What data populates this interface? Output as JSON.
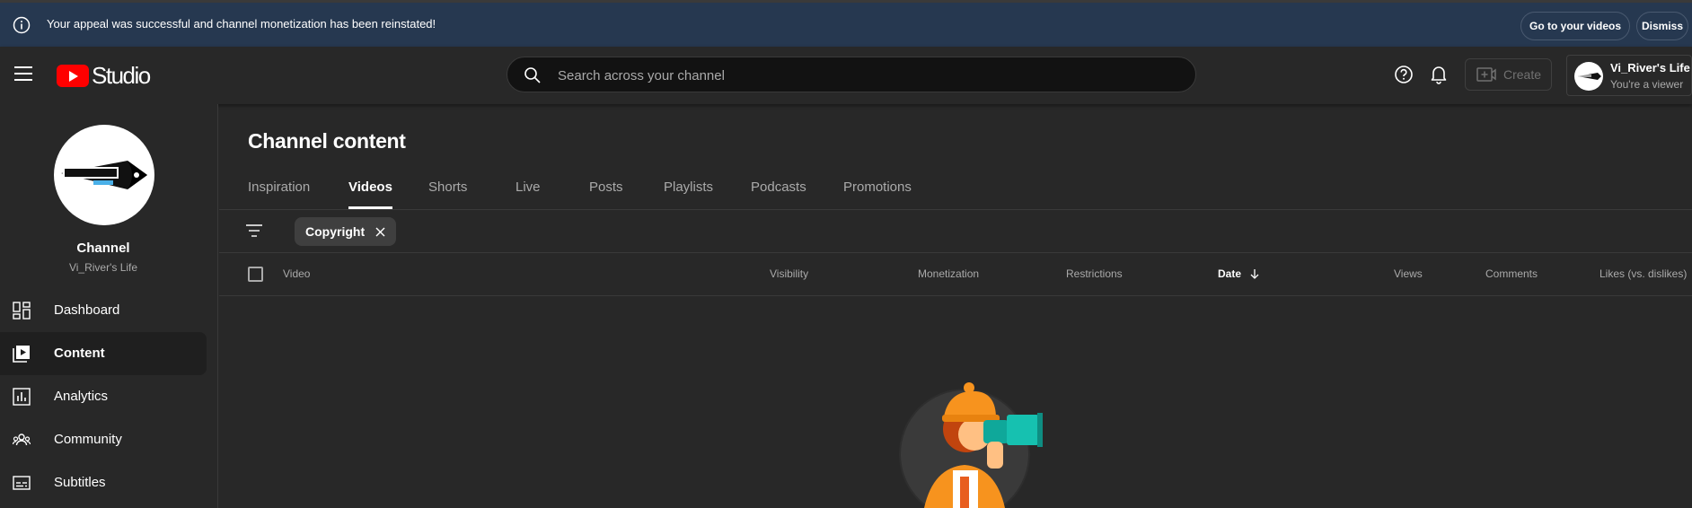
{
  "banner": {
    "message": "Your appeal was successful and channel monetization has been reinstated!",
    "go_label": "Go to your videos",
    "dismiss_label": "Dismiss"
  },
  "topbar": {
    "logo_text": "Studio",
    "search_placeholder": "Search across your channel",
    "create_label": "Create",
    "account_name": "Vi_River's Life",
    "account_role": "You're a viewer"
  },
  "sidebar": {
    "channel_title": "Channel",
    "channel_name": "Vi_River's Life",
    "items": [
      {
        "label": "Dashboard",
        "icon": "dashboard-icon"
      },
      {
        "label": "Content",
        "icon": "content-icon",
        "active": true
      },
      {
        "label": "Analytics",
        "icon": "analytics-icon"
      },
      {
        "label": "Community",
        "icon": "community-icon"
      },
      {
        "label": "Subtitles",
        "icon": "subtitles-icon"
      }
    ]
  },
  "main": {
    "title": "Channel content",
    "tabs": [
      {
        "label": "Inspiration"
      },
      {
        "label": "Videos",
        "active": true
      },
      {
        "label": "Shorts"
      },
      {
        "label": "Live"
      },
      {
        "label": "Posts"
      },
      {
        "label": "Playlists"
      },
      {
        "label": "Podcasts"
      },
      {
        "label": "Promotions"
      }
    ],
    "filter_chip": "Copyright",
    "columns": {
      "video": "Video",
      "visibility": "Visibility",
      "monetization": "Monetization",
      "restrictions": "Restrictions",
      "date": "Date",
      "views": "Views",
      "comments": "Comments",
      "likes": "Likes (vs. dislikes)"
    },
    "sort_column": "Date",
    "sort_direction": "descending"
  },
  "colors": {
    "banner_bg": "#263850",
    "page_bg": "#282828",
    "youtube_red": "#ff0000"
  }
}
